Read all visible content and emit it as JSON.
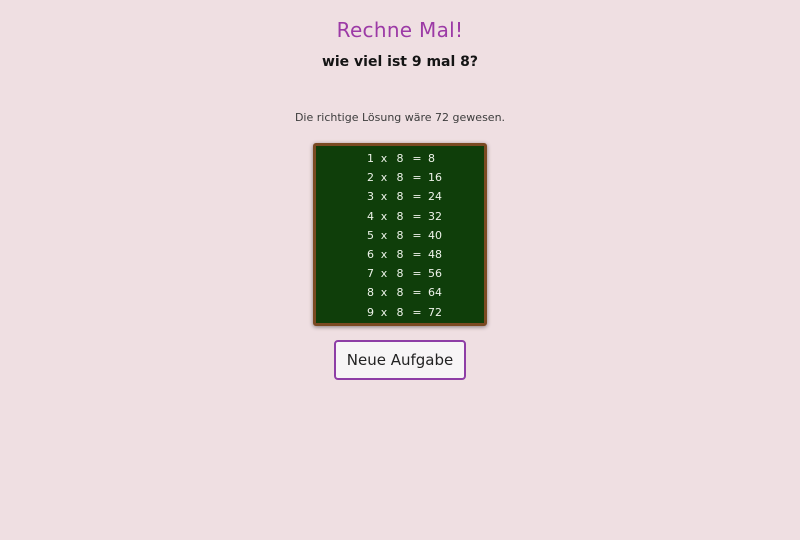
{
  "title": "Rechne Mal!",
  "question": "wie viel ist 9 mal 8?",
  "solution_text": "Die richtige Lösung wäre 72 gewesen.",
  "blackboard": {
    "rows": [
      {
        "a": "1",
        "times": "x",
        "b": "8",
        "eq": "=",
        "result": "8"
      },
      {
        "a": "2",
        "times": "x",
        "b": "8",
        "eq": "=",
        "result": "16"
      },
      {
        "a": "3",
        "times": "x",
        "b": "8",
        "eq": "=",
        "result": "24"
      },
      {
        "a": "4",
        "times": "x",
        "b": "8",
        "eq": "=",
        "result": "32"
      },
      {
        "a": "5",
        "times": "x",
        "b": "8",
        "eq": "=",
        "result": "40"
      },
      {
        "a": "6",
        "times": "x",
        "b": "8",
        "eq": "=",
        "result": "48"
      },
      {
        "a": "7",
        "times": "x",
        "b": "8",
        "eq": "=",
        "result": "56"
      },
      {
        "a": "8",
        "times": "x",
        "b": "8",
        "eq": "=",
        "result": "64"
      },
      {
        "a": "9",
        "times": "x",
        "b": "8",
        "eq": "=",
        "result": "72"
      }
    ]
  },
  "new_task_button": "Neue Aufgabe",
  "colors": {
    "background": "#efdfe2",
    "title": "#9c3aa6",
    "blackboard": "#0f3e0a",
    "blackboard_frame": "#7a4a22",
    "button_border": "#8e3ea6"
  }
}
